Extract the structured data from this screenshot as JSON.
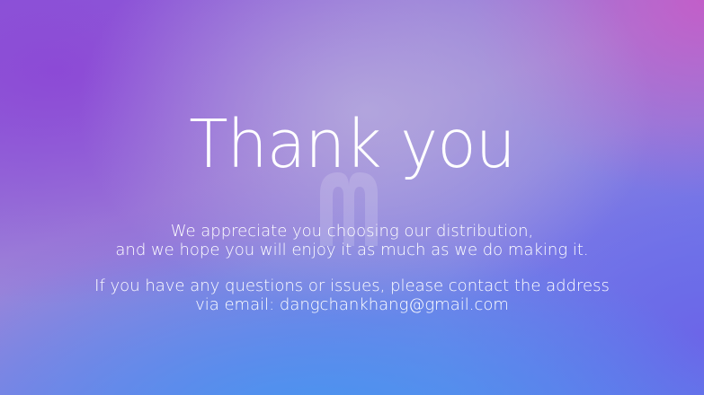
{
  "slide": {
    "title": "Thank you",
    "appreciation": {
      "line1": "We appreciate you choosing our distribution,",
      "line2": "and we hope you will enjoy it as much as we do making it."
    },
    "contact": {
      "line1": "If you have any questions or issues, please contact the address",
      "line2": "via email: dangchankhang@gmail.com"
    },
    "watermark_icon": "distro-logo-icon"
  }
}
